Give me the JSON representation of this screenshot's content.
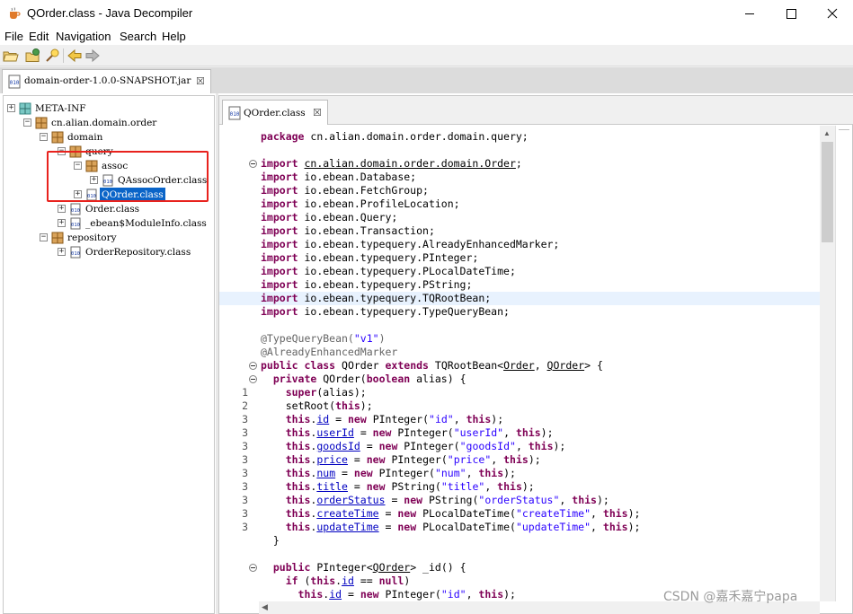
{
  "window": {
    "title": "QOrder.class - Java Decompiler"
  },
  "menu": [
    "File",
    "Edit",
    "Navigation",
    "Search",
    "Help"
  ],
  "toolbar_icons": [
    "open-file-icon",
    "open-type-icon",
    "search-icon",
    "back-icon",
    "forward-icon"
  ],
  "jar_tab": {
    "label": "domain-order-1.0.0-SNAPSHOT.jar",
    "close": "☒"
  },
  "tree": {
    "items": [
      {
        "label": "META-INF",
        "icon": "folder-icon",
        "expander": "+"
      },
      {
        "label": "cn.alian.domain.order",
        "icon": "package-icon",
        "expander": "−"
      },
      {
        "label": "domain",
        "icon": "package-icon",
        "expander": "−"
      },
      {
        "label": "query",
        "icon": "package-icon",
        "expander": "−"
      },
      {
        "label": "assoc",
        "icon": "package-icon",
        "expander": "−"
      },
      {
        "label": "QAssocOrder.class",
        "icon": "class-file-icon",
        "expander": "+"
      },
      {
        "label": "QOrder.class",
        "icon": "class-file-icon",
        "expander": "+",
        "selected": true
      },
      {
        "label": "Order.class",
        "icon": "class-file-icon",
        "expander": "+"
      },
      {
        "label": "_ebean$ModuleInfo.class",
        "icon": "class-file-icon",
        "expander": "+"
      },
      {
        "label": "repository",
        "icon": "package-icon",
        "expander": "−"
      },
      {
        "label": "OrderRepository.class",
        "icon": "class-file-icon",
        "expander": "+"
      }
    ]
  },
  "editor": {
    "tab": {
      "label": "QOrder.class",
      "close": "☒"
    },
    "lines": [
      {
        "ln": "",
        "fold": false,
        "html": "<span class=\"kw\">package</span> cn.alian.domain.order.domain.query;"
      },
      {
        "ln": "",
        "fold": false,
        "html": ""
      },
      {
        "ln": "",
        "fold": true,
        "html": "<span class=\"kw\">import</span> <span class=\"ul\">cn.alian.domain.order.domain.Order</span>;"
      },
      {
        "ln": "",
        "fold": false,
        "html": "<span class=\"kw\">import</span> io.ebean.Database;"
      },
      {
        "ln": "",
        "fold": false,
        "html": "<span class=\"kw\">import</span> io.ebean.FetchGroup;"
      },
      {
        "ln": "",
        "fold": false,
        "html": "<span class=\"kw\">import</span> io.ebean.ProfileLocation;"
      },
      {
        "ln": "",
        "fold": false,
        "html": "<span class=\"kw\">import</span> io.ebean.Query;"
      },
      {
        "ln": "",
        "fold": false,
        "html": "<span class=\"kw\">import</span> io.ebean.Transaction;"
      },
      {
        "ln": "",
        "fold": false,
        "html": "<span class=\"kw\">import</span> io.ebean.typequery.AlreadyEnhancedMarker;"
      },
      {
        "ln": "",
        "fold": false,
        "html": "<span class=\"kw\">import</span> io.ebean.typequery.PInteger;"
      },
      {
        "ln": "",
        "fold": false,
        "html": "<span class=\"kw\">import</span> io.ebean.typequery.PLocalDateTime;"
      },
      {
        "ln": "",
        "fold": false,
        "html": "<span class=\"kw\">import</span> io.ebean.typequery.PString;"
      },
      {
        "ln": "",
        "fold": false,
        "hl": true,
        "html": "<span class=\"kw\">import</span> io.ebean.typequery.TQRootBean;"
      },
      {
        "ln": "",
        "fold": false,
        "html": "<span class=\"kw\">import</span> io.ebean.typequery.TypeQueryBean;"
      },
      {
        "ln": "",
        "fold": false,
        "html": ""
      },
      {
        "ln": "",
        "fold": false,
        "html": "<span class=\"ann\">@TypeQueryBean(</span><span class=\"str\">\"v1\"</span><span class=\"ann\">)</span>"
      },
      {
        "ln": "",
        "fold": false,
        "html": "<span class=\"ann\">@AlreadyEnhancedMarker</span>"
      },
      {
        "ln": "",
        "fold": true,
        "html": "<span class=\"kw\">public</span> <span class=\"kw\">class</span> QOrder <span class=\"kw\">extends</span> TQRootBean&lt;<span class=\"ul\">Order</span>, <span class=\"ul\">QOrder</span>&gt; {"
      },
      {
        "ln": "",
        "fold": true,
        "html": "  <span class=\"kw\">private</span> QOrder(<span class=\"kw\">boolean</span> alias) {"
      },
      {
        "ln": "1",
        "fold": false,
        "html": "    <span class=\"kw\">super</span>(alias);"
      },
      {
        "ln": "2",
        "fold": false,
        "html": "    setRoot(<span class=\"kw\">this</span>);"
      },
      {
        "ln": "3",
        "fold": false,
        "html": "    <span class=\"kw\">this</span>.<span class=\"fld\">id</span> = <span class=\"kw\">new</span> PInteger(<span class=\"str\">\"id\"</span>, <span class=\"kw\">this</span>);"
      },
      {
        "ln": "3",
        "fold": false,
        "html": "    <span class=\"kw\">this</span>.<span class=\"fld\">userId</span> = <span class=\"kw\">new</span> PInteger(<span class=\"str\">\"userId\"</span>, <span class=\"kw\">this</span>);"
      },
      {
        "ln": "3",
        "fold": false,
        "html": "    <span class=\"kw\">this</span>.<span class=\"fld\">goodsId</span> = <span class=\"kw\">new</span> PInteger(<span class=\"str\">\"goodsId\"</span>, <span class=\"kw\">this</span>);"
      },
      {
        "ln": "3",
        "fold": false,
        "html": "    <span class=\"kw\">this</span>.<span class=\"fld\">price</span> = <span class=\"kw\">new</span> PInteger(<span class=\"str\">\"price\"</span>, <span class=\"kw\">this</span>);"
      },
      {
        "ln": "3",
        "fold": false,
        "html": "    <span class=\"kw\">this</span>.<span class=\"fld\">num</span> = <span class=\"kw\">new</span> PInteger(<span class=\"str\">\"num\"</span>, <span class=\"kw\">this</span>);"
      },
      {
        "ln": "3",
        "fold": false,
        "html": "    <span class=\"kw\">this</span>.<span class=\"fld\">title</span> = <span class=\"kw\">new</span> PString(<span class=\"str\">\"title\"</span>, <span class=\"kw\">this</span>);"
      },
      {
        "ln": "3",
        "fold": false,
        "html": "    <span class=\"kw\">this</span>.<span class=\"fld\">orderStatus</span> = <span class=\"kw\">new</span> PString(<span class=\"str\">\"orderStatus\"</span>, <span class=\"kw\">this</span>);"
      },
      {
        "ln": "3",
        "fold": false,
        "html": "    <span class=\"kw\">this</span>.<span class=\"fld\">createTime</span> = <span class=\"kw\">new</span> PLocalDateTime(<span class=\"str\">\"createTime\"</span>, <span class=\"kw\">this</span>);"
      },
      {
        "ln": "3",
        "fold": false,
        "html": "    <span class=\"kw\">this</span>.<span class=\"fld\">updateTime</span> = <span class=\"kw\">new</span> PLocalDateTime(<span class=\"str\">\"updateTime\"</span>, <span class=\"kw\">this</span>);"
      },
      {
        "ln": "",
        "fold": false,
        "html": "  }"
      },
      {
        "ln": "",
        "fold": false,
        "html": ""
      },
      {
        "ln": "",
        "fold": true,
        "html": "  <span class=\"kw\">public</span> PInteger&lt;<span class=\"ul\">QOrder</span>&gt; _id() {"
      },
      {
        "ln": "",
        "fold": false,
        "html": "    <span class=\"kw\">if</span> (<span class=\"kw\">this</span>.<span class=\"fld\">id</span> == <span class=\"kw\">null</span>)"
      },
      {
        "ln": "",
        "fold": false,
        "html": "      <span class=\"kw\">this</span>.<span class=\"fld\">id</span> = <span class=\"kw\">new</span> PInteger(<span class=\"str\">\"id\"</span>, <span class=\"kw\">this</span>);"
      }
    ]
  },
  "watermark": "CSDN @嘉禾嘉宁papa",
  "colors": {
    "selection": "#0a64c8",
    "keyword": "#7f0055",
    "string": "#2a00ff",
    "annotation": "#646464",
    "field": "#0000c0",
    "highlight_line": "#e8f2fe",
    "annotation_box": "#e8221d"
  }
}
